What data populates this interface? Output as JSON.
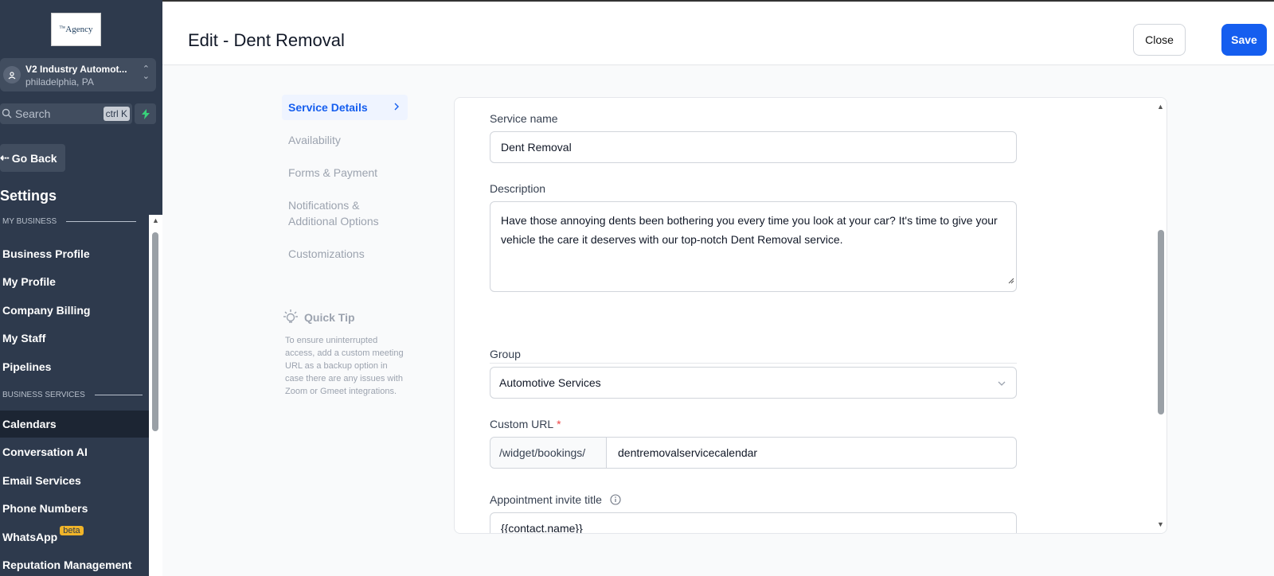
{
  "sidebar": {
    "logo_text": "Agency",
    "logo_sup": "The",
    "account": {
      "name": "V2 Industry Automot...",
      "location": "philadelphia, PA"
    },
    "search": {
      "placeholder": "Search",
      "shortcut": "ctrl K"
    },
    "go_back_label": "Go Back",
    "settings_title": "Settings",
    "sections": [
      {
        "label": "MY BUSINESS",
        "items": [
          "Business Profile",
          "My Profile",
          "Company Billing",
          "My Staff",
          "Pipelines"
        ]
      },
      {
        "label": "BUSINESS SERVICES",
        "items": [
          "Calendars",
          "Conversation AI",
          "Email Services",
          "Phone Numbers",
          "WhatsApp",
          "Reputation Management"
        ]
      }
    ],
    "active_item": "Calendars",
    "whatsapp_badge": "beta"
  },
  "header": {
    "title": "Edit - Dent Removal",
    "close_label": "Close",
    "save_label": "Save"
  },
  "steps": [
    {
      "label": "Service Details",
      "active": true
    },
    {
      "label": "Availability",
      "active": false
    },
    {
      "label": "Forms & Payment",
      "active": false
    },
    {
      "label": "Notifications & Additional Options",
      "active": false
    },
    {
      "label": "Customizations",
      "active": false
    }
  ],
  "quick_tip": {
    "title": "Quick Tip",
    "body": "To ensure uninterrupted access, add a custom meeting URL as a backup option in case there are any issues with Zoom or Gmeet integrations."
  },
  "form": {
    "service_name_label": "Service name",
    "service_name_value": "Dent Removal",
    "description_label": "Description",
    "description_value": "Have those annoying dents been bothering you every time you look at your car? It's time to give your vehicle the care it deserves with our top-notch Dent Removal service.",
    "group_label": "Group",
    "group_value": "Automotive Services",
    "custom_url_label": "Custom URL",
    "custom_url_required": "*",
    "custom_url_prefix": "/widget/bookings/",
    "custom_url_value": "dentremovalservicecalendar",
    "invite_title_label": "Appointment invite title",
    "invite_title_value": "{{contact.name}}"
  },
  "colors": {
    "sidebar_bg": "#2e3a4d",
    "primary": "#155eef",
    "beta_badge": "#f0b429"
  }
}
